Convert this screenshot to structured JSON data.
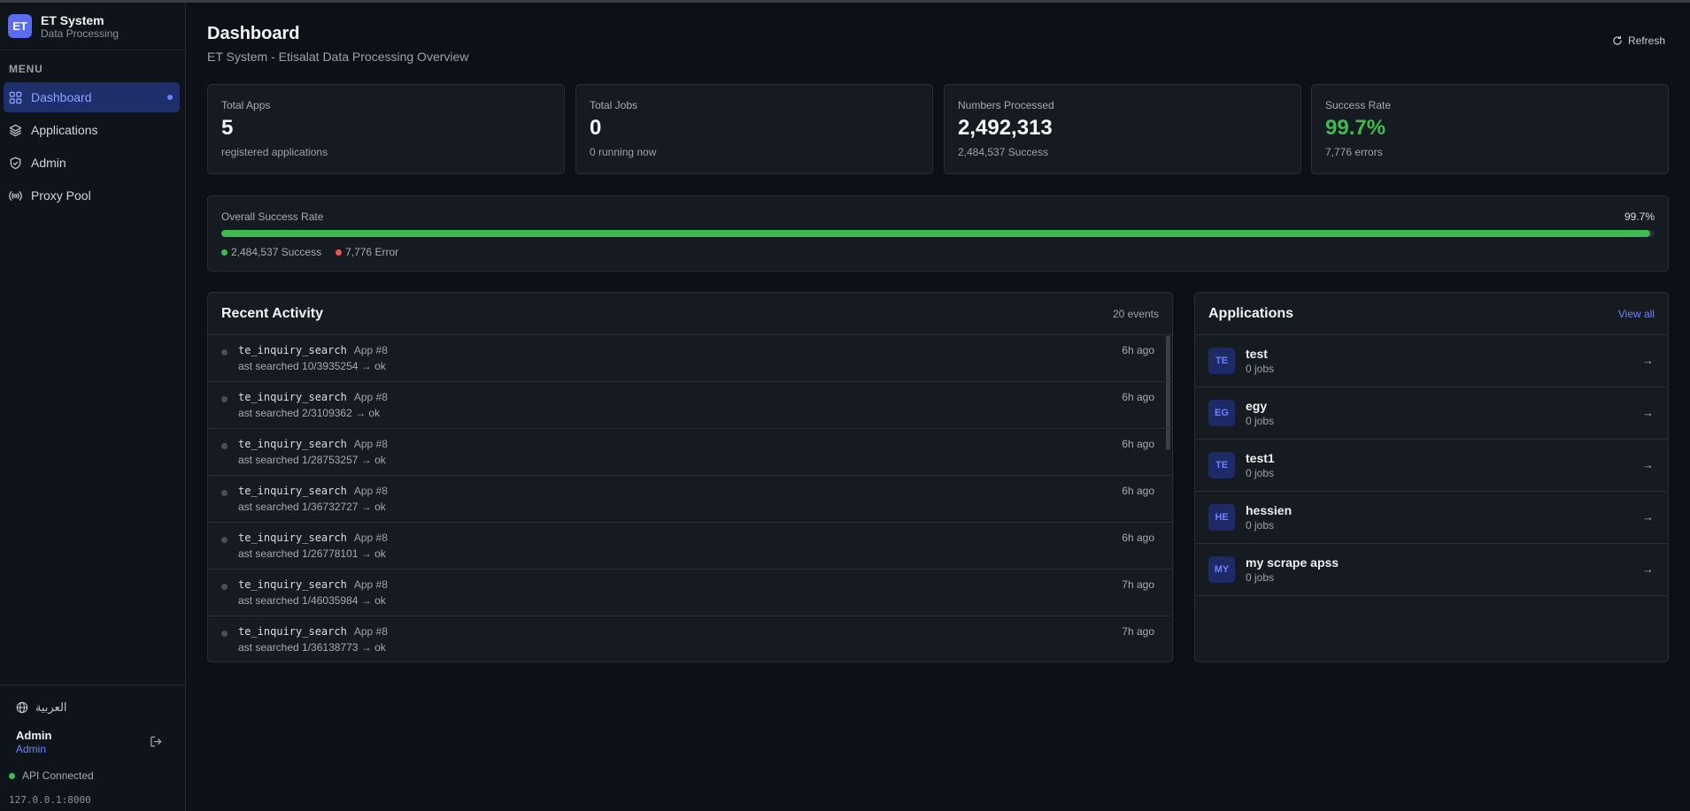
{
  "brand": {
    "logo": "ET",
    "name": "ET System",
    "subtitle": "Data Processing"
  },
  "sidebar": {
    "menu_label": "MENU",
    "items": [
      {
        "label": "Dashboard",
        "icon": "grid-icon",
        "active": true
      },
      {
        "label": "Applications",
        "icon": "layers-icon"
      },
      {
        "label": "Admin",
        "icon": "shield-icon"
      },
      {
        "label": "Proxy Pool",
        "icon": "radio-icon"
      }
    ],
    "language": "العربية",
    "user": {
      "name": "Admin",
      "role": "Admin"
    },
    "api_status": "API Connected",
    "host": "127.0.0.1:8000"
  },
  "header": {
    "title": "Dashboard",
    "subtitle": "ET System - Etisalat Data Processing Overview",
    "refresh_label": "Refresh"
  },
  "stats": [
    {
      "label": "Total Apps",
      "value": "5",
      "note": "registered applications"
    },
    {
      "label": "Total Jobs",
      "value": "0",
      "note": "0 running now"
    },
    {
      "label": "Numbers Processed",
      "value": "2,492,313",
      "note": "2,484,537 Success"
    },
    {
      "label": "Success Rate",
      "value": "99.7%",
      "note": "7,776 errors"
    }
  ],
  "success_rate": {
    "label": "Overall Success Rate",
    "percent_label": "99.7%",
    "fraction": 0.997,
    "success_label": "2,484,537 Success",
    "error_label": "7,776 Error",
    "success_color": "#3fb950",
    "error_color": "#f85149"
  },
  "activity": {
    "title": "Recent Activity",
    "count": "20 events",
    "events": [
      {
        "name": "te_inquiry_search",
        "app": "App #8",
        "desc": "ast searched 10/3935254 → ok",
        "time": "6h ago"
      },
      {
        "name": "te_inquiry_search",
        "app": "App #8",
        "desc": "ast searched 2/3109362 → ok",
        "time": "6h ago"
      },
      {
        "name": "te_inquiry_search",
        "app": "App #8",
        "desc": "ast searched 1/28753257 → ok",
        "time": "6h ago"
      },
      {
        "name": "te_inquiry_search",
        "app": "App #8",
        "desc": "ast searched 1/36732727 → ok",
        "time": "6h ago"
      },
      {
        "name": "te_inquiry_search",
        "app": "App #8",
        "desc": "ast searched 1/26778101 → ok",
        "time": "6h ago"
      },
      {
        "name": "te_inquiry_search",
        "app": "App #8",
        "desc": "ast searched 1/46035984 → ok",
        "time": "7h ago"
      },
      {
        "name": "te_inquiry_search",
        "app": "App #8",
        "desc": "ast searched 1/36138773 → ok",
        "time": "7h ago"
      }
    ]
  },
  "applications": {
    "title": "Applications",
    "view_all": "View all",
    "arrow": "→",
    "items": [
      {
        "initials": "TE",
        "name": "test",
        "jobs": "0 jobs"
      },
      {
        "initials": "EG",
        "name": "egy",
        "jobs": "0 jobs"
      },
      {
        "initials": "TE",
        "name": "test1",
        "jobs": "0 jobs"
      },
      {
        "initials": "HE",
        "name": "hessien",
        "jobs": "0 jobs"
      },
      {
        "initials": "MY",
        "name": "my scrape apss",
        "jobs": "0 jobs"
      }
    ]
  }
}
